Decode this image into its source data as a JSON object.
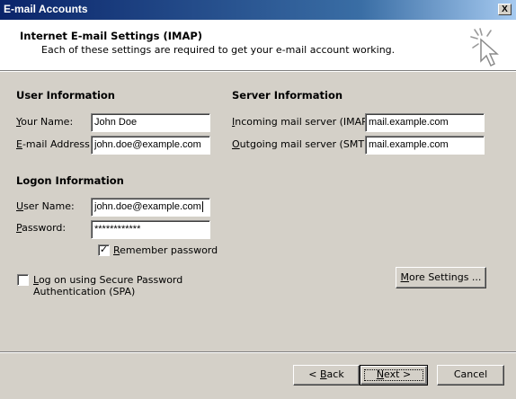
{
  "window": {
    "title": "E-mail Accounts",
    "close_label": "X"
  },
  "header": {
    "title": "Internet E-mail Settings (IMAP)",
    "subtitle": "Each of these settings are required to get your e-mail account working.",
    "icon": "wizard-arrow-icon"
  },
  "user_info": {
    "heading": "User Information",
    "name_label_u": "Y",
    "name_label_rest": "our Name:",
    "name_value": "John Doe",
    "email_label_u": "E",
    "email_label_rest": "-mail Address:",
    "email_value": "john.doe@example.com"
  },
  "server_info": {
    "heading": "Server Information",
    "incoming_label_u": "I",
    "incoming_label_rest": "ncoming mail server (IMAP):",
    "incoming_value": "mail.example.com",
    "outgoing_label_u": "O",
    "outgoing_label_rest": "utgoing mail server (SMTP):",
    "outgoing_value": "mail.example.com"
  },
  "logon_info": {
    "heading": "Logon Information",
    "username_label_u": "U",
    "username_label_rest": "ser Name:",
    "username_value": "john.doe@example.com",
    "password_label_u": "P",
    "password_label_rest": "assword:",
    "password_value": "************",
    "remember_label_u": "R",
    "remember_label_rest": "emember password",
    "remember_checked": true
  },
  "spa": {
    "label_u": "L",
    "label_rest": "og on using Secure Password",
    "label_line2": "Authentication (SPA)",
    "checked": false
  },
  "buttons": {
    "more_settings_u": "M",
    "more_settings_rest": "ore Settings ...",
    "back_prefix": "< ",
    "back_u": "B",
    "back_rest": "ack",
    "next_u": "N",
    "next_rest": "ext >",
    "cancel": "Cancel"
  },
  "colors": {
    "title_bar": "#0a246a",
    "dialog_bg": "#d4d0c8"
  }
}
